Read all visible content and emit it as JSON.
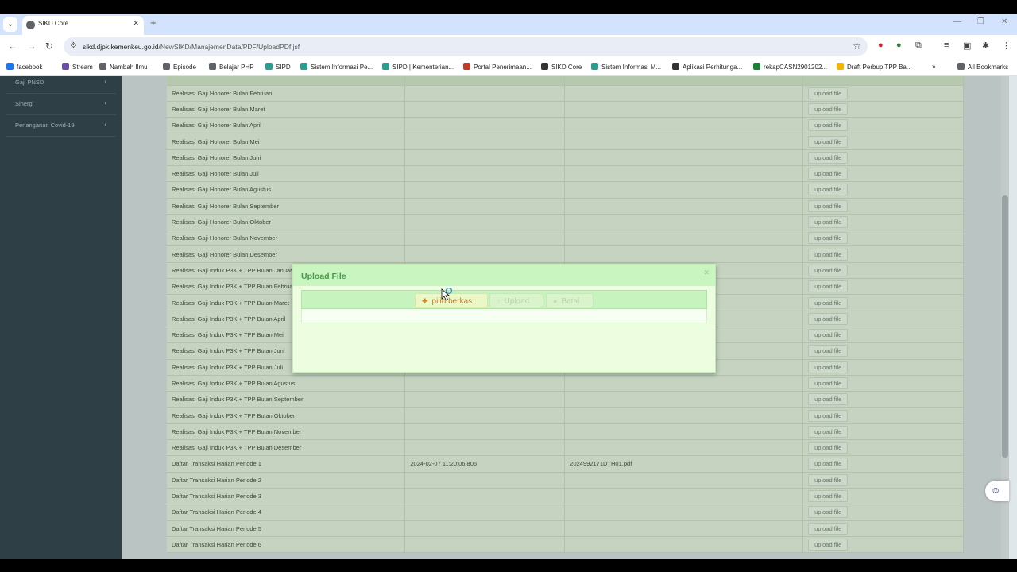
{
  "browser": {
    "tab_title": "SIKD Core",
    "url_host": "sikd.djpk.kemenkeu.go.id",
    "url_path": "/NewSIKD/ManajemenData/PDF/UploadPDf.jsf",
    "bookmarks": [
      {
        "label": "facebook",
        "color": "#1877f2"
      },
      {
        "label": "Stream",
        "color": "#6b4fa3"
      },
      {
        "label": "Nambah Ilmu",
        "color": "#5f6368"
      },
      {
        "label": "Episode",
        "color": "#5f6368"
      },
      {
        "label": "Belajar PHP",
        "color": "#5f6368"
      },
      {
        "label": "SIPD",
        "color": "#2a9d8f"
      },
      {
        "label": "Sistem Informasi Pe...",
        "color": "#2a9d8f"
      },
      {
        "label": "SIPD | Kementerian...",
        "color": "#2a9d8f"
      },
      {
        "label": "Portal Penerimaan...",
        "color": "#c0392b"
      },
      {
        "label": "SIKD Core",
        "color": "#333333"
      },
      {
        "label": "Sistem Informasi M...",
        "color": "#2a9d8f"
      },
      {
        "label": "Aplikasi Perhitunga...",
        "color": "#333333"
      },
      {
        "label": "rekapCASN2901202...",
        "color": "#188038"
      },
      {
        "label": "Draft Perbup TPP Ba...",
        "color": "#f4b400"
      }
    ],
    "all_bookmarks": "All Bookmarks"
  },
  "sidebar": {
    "items": [
      "Gaji PNSD",
      "Sinergi",
      "Penanganan Covid-19"
    ]
  },
  "table": {
    "upload_label": "upload file",
    "rows": [
      {
        "name": "Realisasi Gaji Honorer Bulan Februari",
        "date": "",
        "file": ""
      },
      {
        "name": "Realisasi Gaji Honorer Bulan Maret",
        "date": "",
        "file": ""
      },
      {
        "name": "Realisasi Gaji Honorer Bulan April",
        "date": "",
        "file": ""
      },
      {
        "name": "Realisasi Gaji Honorer Bulan Mei",
        "date": "",
        "file": ""
      },
      {
        "name": "Realisasi Gaji Honorer Bulan Juni",
        "date": "",
        "file": ""
      },
      {
        "name": "Realisasi Gaji Honorer Bulan Juli",
        "date": "",
        "file": ""
      },
      {
        "name": "Realisasi Gaji Honorer Bulan Agustus",
        "date": "",
        "file": ""
      },
      {
        "name": "Realisasi Gaji Honorer Bulan September",
        "date": "",
        "file": ""
      },
      {
        "name": "Realisasi Gaji Honorer Bulan Oktober",
        "date": "",
        "file": ""
      },
      {
        "name": "Realisasi Gaji Honorer Bulan November",
        "date": "",
        "file": ""
      },
      {
        "name": "Realisasi Gaji Honorer Bulan Desember",
        "date": "",
        "file": ""
      },
      {
        "name": "Realisasi Gaji Induk P3K + TPP Bulan Januari",
        "date": "",
        "file": ""
      },
      {
        "name": "Realisasi Gaji Induk P3K + TPP Bulan Februari",
        "date": "",
        "file": ""
      },
      {
        "name": "Realisasi Gaji Induk P3K + TPP Bulan Maret",
        "date": "",
        "file": ""
      },
      {
        "name": "Realisasi Gaji Induk P3K + TPP Bulan April",
        "date": "",
        "file": ""
      },
      {
        "name": "Realisasi Gaji Induk P3K + TPP Bulan Mei",
        "date": "",
        "file": ""
      },
      {
        "name": "Realisasi Gaji Induk P3K + TPP Bulan Juni",
        "date": "",
        "file": ""
      },
      {
        "name": "Realisasi Gaji Induk P3K + TPP Bulan Juli",
        "date": "",
        "file": ""
      },
      {
        "name": "Realisasi Gaji Induk P3K + TPP Bulan Agustus",
        "date": "",
        "file": ""
      },
      {
        "name": "Realisasi Gaji Induk P3K + TPP Bulan September",
        "date": "",
        "file": ""
      },
      {
        "name": "Realisasi Gaji Induk P3K + TPP Bulan Oktober",
        "date": "",
        "file": ""
      },
      {
        "name": "Realisasi Gaji Induk P3K + TPP Bulan November",
        "date": "",
        "file": ""
      },
      {
        "name": "Realisasi Gaji Induk P3K + TPP Bulan Desember",
        "date": "",
        "file": ""
      },
      {
        "name": "Daftar Transaksi Harian Periode 1",
        "date": "2024-02-07 11:20:06.806",
        "file": "2024992171DTH01.pdf"
      },
      {
        "name": "Daftar Transaksi Harian Periode 2",
        "date": "",
        "file": ""
      },
      {
        "name": "Daftar Transaksi Harian Periode 3",
        "date": "",
        "file": ""
      },
      {
        "name": "Daftar Transaksi Harian Periode 4",
        "date": "",
        "file": ""
      },
      {
        "name": "Daftar Transaksi Harian Periode 5",
        "date": "",
        "file": ""
      },
      {
        "name": "Daftar Transaksi Harian Periode 6",
        "date": "",
        "file": ""
      }
    ]
  },
  "dialog": {
    "title": "Upload File",
    "choose_label": "pilih berkas",
    "upload_label": "Upload",
    "cancel_label": "Batal"
  },
  "icons": {
    "choose": "plus-icon",
    "upload": "upload-icon",
    "cancel": "cancel-icon"
  }
}
